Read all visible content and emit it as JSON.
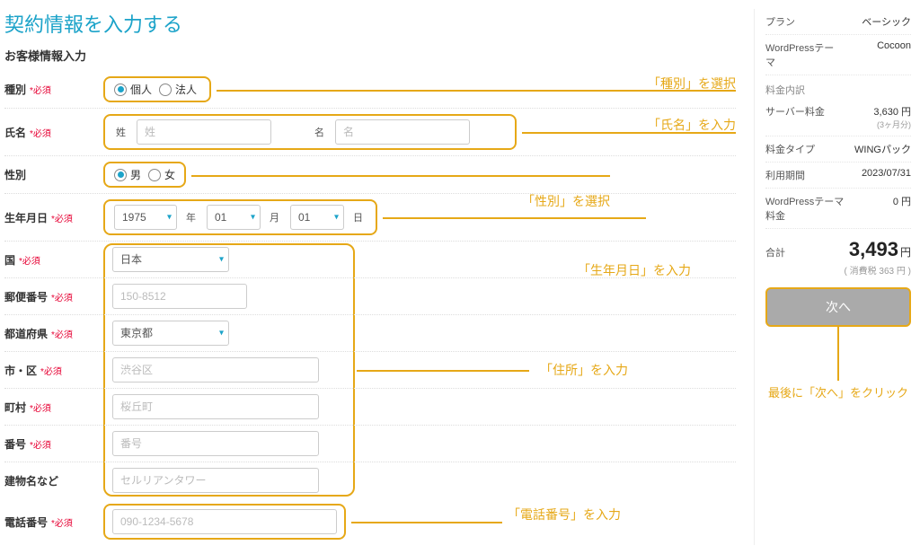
{
  "title": "契約情報を入力する",
  "section_head": "お客様情報入力",
  "required_mark": "*必須",
  "labels": {
    "type": "種別",
    "name": "氏名",
    "gender": "性別",
    "birth": "生年月日",
    "country": "国",
    "postal": "郵便番号",
    "pref": "都道府県",
    "city": "市・区",
    "town": "町村",
    "number": "番号",
    "building": "建物名など",
    "phone": "電話番号"
  },
  "type_opts": {
    "personal": "個人",
    "corporate": "法人"
  },
  "name_fields": {
    "sei_label": "姓",
    "sei_ph": "姓",
    "mei_label": "名",
    "mei_ph": "名"
  },
  "gender_opts": {
    "male": "男",
    "female": "女"
  },
  "birth": {
    "year": "1975",
    "year_unit": "年",
    "month": "01",
    "month_unit": "月",
    "day": "01",
    "day_unit": "日"
  },
  "country_val": "日本",
  "postal_ph": "150-8512",
  "pref_val": "東京都",
  "city_ph": "渋谷区",
  "town_ph": "桜丘町",
  "number_ph": "番号",
  "building_ph": "セルリアンタワー",
  "phone_ph": "090-1234-5678",
  "callouts": {
    "type": "「種別」を選択",
    "name": "「氏名」を入力",
    "gender": "「性別」を選択",
    "birth": "「生年月日」を入力",
    "addr": "「住所」を入力",
    "phone": "「電話番号」を入力",
    "next": "最後に「次へ」をクリック"
  },
  "sidebar": {
    "plan_label": "プラン",
    "plan_value": "ベーシック",
    "wp_label": "WordPressテーマ",
    "wp_value": "Cocoon",
    "detail_head": "料金内訳",
    "server_label": "サーバー料金",
    "server_value": "3,630 円",
    "server_sub": "(3ヶ月分)",
    "type_label": "料金タイプ",
    "type_value": "WINGパック",
    "period_label": "利用期間",
    "period_value": "2023/07/31",
    "wpfee_label": "WordPressテーマ料金",
    "wpfee_value": "0 円",
    "total_label": "合計",
    "total_value": "3,493",
    "total_yen": "円",
    "tax": "( 消費税 363 円 )",
    "next_btn": "次へ"
  }
}
